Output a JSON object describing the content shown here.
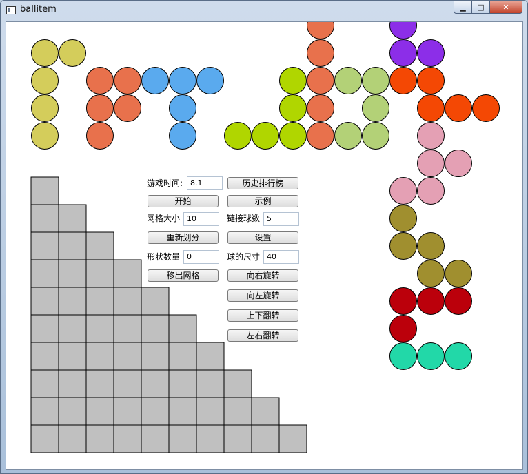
{
  "window": {
    "title": "ballitem",
    "minimize_glyph": "▁",
    "maximize_glyph": "□",
    "close_glyph": "✕"
  },
  "controls": {
    "game_time_label": "游戏时间:",
    "game_time_value": "8.1",
    "leaderboard_button": "历史排行榜",
    "start_button": "开始",
    "example_button": "示例",
    "grid_size_label": "网格大小",
    "grid_size_value": "10",
    "link_count_label": "链接球数",
    "link_count_value": "5",
    "repartition_button": "重新划分",
    "settings_button": "设置",
    "shape_count_label": "形状数量",
    "shape_count_value": "0",
    "ball_size_label": "球的尺寸",
    "ball_size_value": "40",
    "remove_grid_button": "移出网格",
    "rotate_right_button": "向右旋转",
    "rotate_left_button": "向左旋转",
    "flip_vertical_button": "上下翻转",
    "flip_horizontal_button": "左右翻转"
  },
  "board": {
    "grid_size": 10,
    "grid_color": "#c0c0c0",
    "grid_line_color": "#000000"
  },
  "colors": {
    "yellow": "#d4cd5b",
    "orange": "#e8714c",
    "blue": "#5aaaee",
    "lime": "#b0d600",
    "lightgreen": "#b3d177",
    "purple": "#8c2ee8",
    "redorange": "#f44804",
    "pink": "#e4a0b4",
    "olive": "#a08f2f",
    "darkred": "#bb000b",
    "teal": "#22d8a8",
    "window_accent": "#bfcfe0",
    "close_red": "#c2442c"
  },
  "pieces": [
    {
      "name": "yellow-piece",
      "color": "yellow",
      "cells": [
        [
          0,
          0
        ],
        [
          1,
          0
        ],
        [
          0,
          1
        ],
        [
          0,
          2
        ],
        [
          0,
          3
        ]
      ]
    },
    {
      "name": "orange-piece",
      "color": "orange",
      "cells": [
        [
          2,
          1
        ],
        [
          3,
          1
        ],
        [
          2,
          2
        ],
        [
          3,
          2
        ],
        [
          2,
          3
        ]
      ]
    },
    {
      "name": "blue-piece",
      "color": "blue",
      "cells": [
        [
          4,
          1
        ],
        [
          5,
          1
        ],
        [
          6,
          1
        ],
        [
          5,
          2
        ],
        [
          5,
          3
        ]
      ]
    },
    {
      "name": "lime-piece",
      "color": "lime",
      "cells": [
        [
          7,
          3
        ],
        [
          8,
          3
        ],
        [
          9,
          3
        ],
        [
          9,
          2
        ],
        [
          9,
          1
        ]
      ]
    },
    {
      "name": "orange-piece-2",
      "color": "orange",
      "cells": [
        [
          10,
          -1
        ],
        [
          10,
          0
        ],
        [
          10,
          1
        ],
        [
          10,
          2
        ],
        [
          10,
          3
        ]
      ]
    },
    {
      "name": "lightgreen-piece",
      "color": "lightgreen",
      "cells": [
        [
          11,
          1
        ],
        [
          12,
          1
        ],
        [
          12,
          2
        ],
        [
          11,
          3
        ],
        [
          12,
          3
        ]
      ]
    },
    {
      "name": "purple-piece",
      "color": "purple",
      "cells": [
        [
          13,
          -1
        ],
        [
          13,
          0
        ],
        [
          14,
          0
        ]
      ]
    },
    {
      "name": "redorange-piece",
      "color": "redorange",
      "cells": [
        [
          13,
          1
        ],
        [
          14,
          1
        ],
        [
          14,
          2
        ],
        [
          15,
          2
        ],
        [
          16,
          2
        ]
      ]
    },
    {
      "name": "pink-piece",
      "color": "pink",
      "cells": [
        [
          14,
          3
        ],
        [
          14,
          4
        ],
        [
          15,
          4
        ],
        [
          14,
          5
        ],
        [
          13,
          5
        ]
      ]
    },
    {
      "name": "olive-piece",
      "color": "olive",
      "cells": [
        [
          13,
          6
        ],
        [
          13,
          7
        ],
        [
          14,
          7
        ],
        [
          14,
          8
        ],
        [
          15,
          8
        ]
      ]
    },
    {
      "name": "darkred-piece",
      "color": "darkred",
      "cells": [
        [
          13,
          9
        ],
        [
          14,
          9
        ],
        [
          15,
          9
        ],
        [
          13,
          10
        ]
      ]
    },
    {
      "name": "teal-piece",
      "color": "teal",
      "cells": [
        [
          13,
          11
        ],
        [
          14,
          11
        ],
        [
          15,
          11
        ]
      ]
    }
  ]
}
